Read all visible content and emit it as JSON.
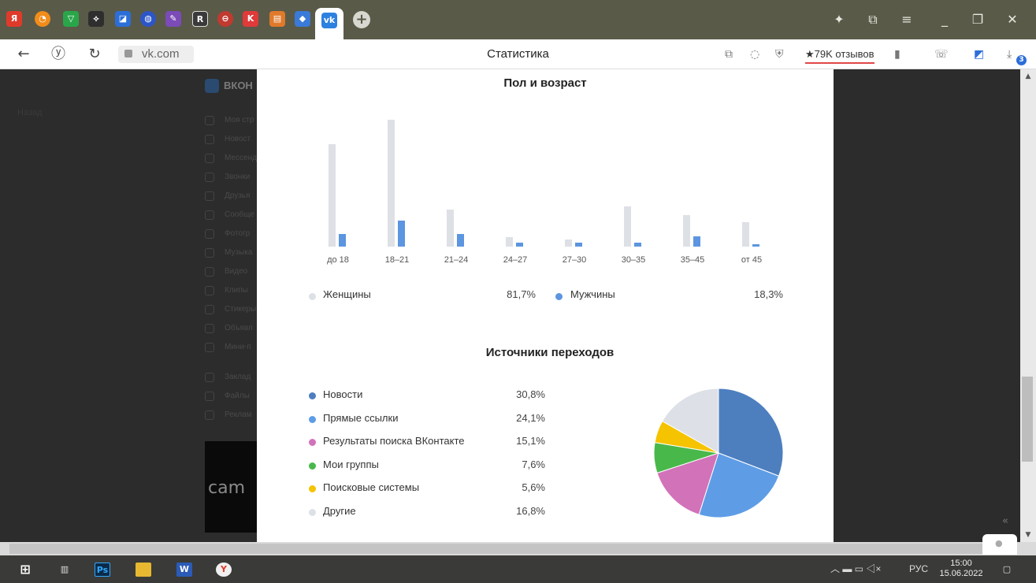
{
  "browser": {
    "url": "vk.com",
    "page_title": "Статистика",
    "reviews_label": "★79K отзывов",
    "downloads_badge": "3"
  },
  "background_page": {
    "brand": "ВКОН",
    "back_link": "Назад",
    "sidebar": [
      "Моя стр",
      "Новост",
      "Мессенд",
      "Звонки",
      "Друзья",
      "Сообще",
      "Фотогр",
      "Музыка",
      "Видео",
      "Клипы",
      "Стикеры",
      "Объявл",
      "Мини-п",
      "Заклад",
      "Файлы",
      "Реклам"
    ],
    "ad_text": "cam"
  },
  "modal": {
    "age_section": {
      "title": "Пол и возраст",
      "chart_data": {
        "type": "bar",
        "categories": [
          "до 18",
          "18–21",
          "21–24",
          "24–27",
          "27–30",
          "30–35",
          "35–45",
          "от 45"
        ],
        "series": [
          {
            "name": "Женщины",
            "values": [
              15.7,
              19.5,
              5.7,
              1.5,
              1.1,
              6.2,
              4.8,
              3.8
            ],
            "color": "#dde0e5"
          },
          {
            "name": "Мужчины",
            "values": [
              2.0,
              4.0,
              1.9,
              0.6,
              0.6,
              0.6,
              1.6,
              0.4
            ],
            "color": "#5c95e0"
          }
        ],
        "ylim": [
          0,
          20
        ],
        "grid": false
      },
      "legend": {
        "female_label": "Женщины",
        "female_value": "81,7%",
        "female_color": "#dde0e5",
        "male_label": "Мужчины",
        "male_value": "18,3%",
        "male_color": "#5c95e0"
      }
    },
    "sources_section": {
      "title": "Источники переходов",
      "chart_data": {
        "type": "pie",
        "categories": [
          "Новости",
          "Прямые ссылки",
          "Результаты поиска ВКонтакте",
          "Мои группы",
          "Поисковые системы",
          "Другие"
        ],
        "values": [
          30.8,
          24.1,
          15.1,
          7.6,
          5.6,
          16.8
        ],
        "value_labels": [
          "30,8%",
          "24,1%",
          "15,1%",
          "7,6%",
          "5,6%",
          "16,8%"
        ],
        "colors": [
          "#4d7fbf",
          "#5e9de6",
          "#d272b9",
          "#48b84a",
          "#f5c300",
          "#dde1e7"
        ]
      }
    }
  },
  "taskbar": {
    "lang": "РУС",
    "time": "15:00",
    "date": "15.06.2022"
  }
}
